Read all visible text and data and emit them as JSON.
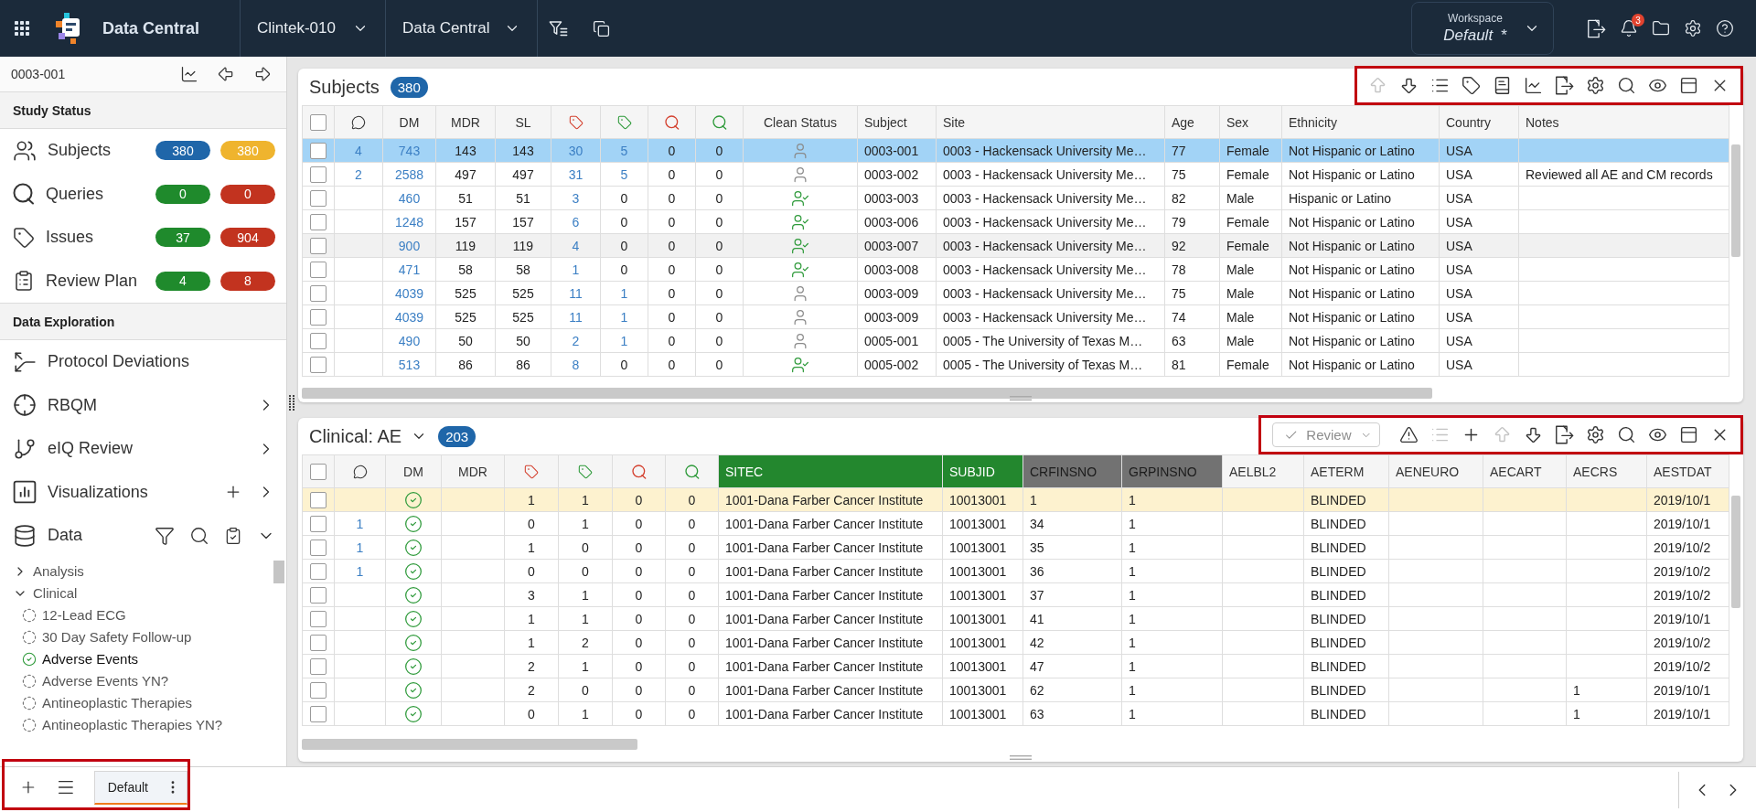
{
  "header": {
    "title": "Data Central",
    "study": "Clintek-010",
    "module": "Data Central",
    "workspace": {
      "label": "Workspace",
      "value": "Default",
      "suffix": "*"
    },
    "notifications": "3"
  },
  "sidebar": {
    "subject": "0003-001",
    "study_status": {
      "title": "Study Status",
      "items": [
        {
          "kind": "subjects",
          "label": "Subjects",
          "badges": [
            {
              "text": "380",
              "color": "#1f66a9"
            },
            {
              "text": "380",
              "color": "#efb42e"
            }
          ]
        },
        {
          "kind": "queries",
          "label": "Queries",
          "badges": [
            {
              "text": "0",
              "color": "#1f8a2c"
            },
            {
              "text": "0",
              "color": "#c2331f"
            }
          ]
        },
        {
          "kind": "issues",
          "label": "Issues",
          "badges": [
            {
              "text": "37",
              "color": "#1f8a2c"
            },
            {
              "text": "904",
              "color": "#c2331f"
            }
          ]
        },
        {
          "kind": "review_plan",
          "label": "Review Plan",
          "badges": [
            {
              "text": "4",
              "color": "#1f8a2c"
            },
            {
              "text": "8",
              "color": "#c2331f"
            }
          ]
        }
      ]
    },
    "data_exploration": {
      "title": "Data Exploration",
      "items": [
        {
          "kind": "protocol_deviations",
          "label": "Protocol Deviations"
        },
        {
          "kind": "rbqm",
          "label": "RBQM",
          "expanded": false
        },
        {
          "kind": "review",
          "label": "eIQ Review",
          "expanded": false
        },
        {
          "kind": "visualizations",
          "label": "Visualizations",
          "expanded": false
        },
        {
          "kind": "data",
          "label": "Data",
          "expanded": true
        }
      ]
    },
    "tree": [
      {
        "label": "Analysis",
        "expanded": false
      },
      {
        "label": "Clinical",
        "expanded": true,
        "children": [
          {
            "label": "12-Lead ECG",
            "complete": false
          },
          {
            "label": "30 Day Safety Follow-up",
            "complete": false
          },
          {
            "label": "Adverse Events",
            "complete": true
          },
          {
            "label": "Adverse Events YN?",
            "complete": false
          },
          {
            "label": "Antineoplastic Therapies",
            "complete": false
          },
          {
            "label": "Antineoplastic Therapies YN?",
            "complete": false
          }
        ]
      }
    ]
  },
  "subjects_panel": {
    "title": "Subjects",
    "count": "380",
    "toolbar": {
      "highlighted": true,
      "tools": [
        {
          "kind": "move_up",
          "disabled": true
        },
        {
          "kind": "move_down",
          "disabled": false
        },
        {
          "kind": "list",
          "disabled": false
        },
        {
          "kind": "tag",
          "disabled": false
        },
        {
          "kind": "book",
          "disabled": false
        },
        {
          "kind": "chart",
          "disabled": false
        },
        {
          "kind": "export",
          "disabled": false
        },
        {
          "kind": "settings",
          "disabled": false
        },
        {
          "kind": "search",
          "disabled": false
        },
        {
          "kind": "view",
          "disabled": false
        },
        {
          "kind": "layout",
          "disabled": false
        },
        {
          "kind": "close",
          "disabled": false
        }
      ]
    },
    "all_checked": false,
    "columns": [
      "DM",
      "MDR",
      "SL",
      "Clean Status",
      "Subject",
      "Site",
      "Age",
      "Sex",
      "Ethnicity",
      "Country",
      "Notes"
    ],
    "rows": [
      {
        "selected": true,
        "hovered": false,
        "checked": false,
        "comments": "4",
        "dm": "743",
        "mdr": "143",
        "sl": "143",
        "issues_open": "30",
        "issues_closed": "5",
        "queries_open": "0",
        "queries_closed": "0",
        "clean": false,
        "subject": "0003-001",
        "site": "0003 - Hackensack University Me…",
        "age": "77",
        "sex": "Female",
        "ethnicity": "Not Hispanic or Latino",
        "country": "USA"
      },
      {
        "selected": false,
        "hovered": false,
        "checked": false,
        "comments": "2",
        "dm": "2588",
        "mdr": "497",
        "sl": "497",
        "issues_open": "31",
        "issues_closed": "5",
        "queries_open": "0",
        "queries_closed": "0",
        "clean": false,
        "subject": "0003-002",
        "site": "0003 - Hackensack University Me…",
        "age": "75",
        "sex": "Female",
        "ethnicity": "Not Hispanic or Latino",
        "country": "USA",
        "notes": "Reviewed all AE and CM records"
      },
      {
        "selected": false,
        "hovered": false,
        "checked": false,
        "dm": "460",
        "mdr": "51",
        "sl": "51",
        "issues_open": "3",
        "issues_closed": "0",
        "queries_open": "0",
        "queries_closed": "0",
        "clean": true,
        "subject": "0003-003",
        "site": "0003 - Hackensack University Me…",
        "age": "82",
        "sex": "Male",
        "ethnicity": "Hispanic or Latino",
        "country": "USA"
      },
      {
        "selected": false,
        "hovered": false,
        "checked": false,
        "dm": "1248",
        "mdr": "157",
        "sl": "157",
        "issues_open": "6",
        "issues_closed": "0",
        "queries_open": "0",
        "queries_closed": "0",
        "clean": true,
        "subject": "0003-006",
        "site": "0003 - Hackensack University Me…",
        "age": "79",
        "sex": "Female",
        "ethnicity": "Not Hispanic or Latino",
        "country": "USA"
      },
      {
        "selected": false,
        "hovered": true,
        "checked": false,
        "dm": "900",
        "mdr": "119",
        "sl": "119",
        "issues_open": "4",
        "issues_closed": "0",
        "queries_open": "0",
        "queries_closed": "0",
        "clean": true,
        "subject": "0003-007",
        "site": "0003 - Hackensack University Me…",
        "age": "92",
        "sex": "Female",
        "ethnicity": "Not Hispanic or Latino",
        "country": "USA"
      },
      {
        "selected": false,
        "hovered": false,
        "checked": false,
        "dm": "471",
        "mdr": "58",
        "sl": "58",
        "issues_open": "1",
        "issues_closed": "0",
        "queries_open": "0",
        "queries_closed": "0",
        "clean": true,
        "subject": "0003-008",
        "site": "0003 - Hackensack University Me…",
        "age": "78",
        "sex": "Male",
        "ethnicity": "Not Hispanic or Latino",
        "country": "USA"
      },
      {
        "selected": false,
        "hovered": false,
        "checked": false,
        "dm": "4039",
        "mdr": "525",
        "sl": "525",
        "issues_open": "11",
        "issues_closed": "1",
        "queries_open": "0",
        "queries_closed": "0",
        "clean": false,
        "subject": "0003-009",
        "site": "0003 - Hackensack University Me…",
        "age": "75",
        "sex": "Male",
        "ethnicity": "Not Hispanic or Latino",
        "country": "USA"
      },
      {
        "selected": false,
        "hovered": false,
        "checked": false,
        "dm": "4039",
        "mdr": "525",
        "sl": "525",
        "issues_open": "11",
        "issues_closed": "1",
        "queries_open": "0",
        "queries_closed": "0",
        "clean": false,
        "subject": "0003-009",
        "site": "0003 - Hackensack University Me…",
        "age": "74",
        "sex": "Male",
        "ethnicity": "Not Hispanic or Latino",
        "country": "USA"
      },
      {
        "selected": false,
        "hovered": false,
        "checked": false,
        "dm": "490",
        "mdr": "50",
        "sl": "50",
        "issues_open": "2",
        "issues_closed": "1",
        "queries_open": "0",
        "queries_closed": "0",
        "clean": false,
        "subject": "0005-001",
        "site": "0005 - The University of Texas M…",
        "age": "63",
        "sex": "Male",
        "ethnicity": "Not Hispanic or Latino",
        "country": "USA"
      },
      {
        "selected": false,
        "hovered": false,
        "checked": false,
        "dm": "513",
        "mdr": "86",
        "sl": "86",
        "issues_open": "8",
        "issues_closed": "0",
        "queries_open": "0",
        "queries_closed": "0",
        "clean": true,
        "subject": "0005-002",
        "site": "0005 - The University of Texas M…",
        "age": "81",
        "sex": "Female",
        "ethnicity": "Not Hispanic or Latino",
        "country": "USA"
      }
    ]
  },
  "ae_panel": {
    "title": "Clinical: AE",
    "count": "203",
    "review": {
      "label": "Review",
      "disabled": true
    },
    "toolbar": {
      "highlighted": true,
      "tools": [
        {
          "kind": "flag_alert",
          "disabled": false
        },
        {
          "kind": "list",
          "disabled": true
        },
        {
          "kind": "add",
          "disabled": false
        },
        {
          "kind": "move_up",
          "disabled": true
        },
        {
          "kind": "move_down",
          "disabled": false
        },
        {
          "kind": "export",
          "disabled": false
        },
        {
          "kind": "settings",
          "disabled": false
        },
        {
          "kind": "search",
          "disabled": false
        },
        {
          "kind": "view",
          "disabled": false
        },
        {
          "kind": "layout",
          "disabled": false
        },
        {
          "kind": "close",
          "disabled": false
        }
      ]
    },
    "all_checked": false,
    "columns": [
      {
        "label": "DM"
      },
      {
        "label": "MDR"
      },
      {
        "label": "SITEC",
        "color": "#23872e"
      },
      {
        "label": "SUBJID",
        "color": "#23872e"
      },
      {
        "label": "CRFINSNO",
        "color": "#727272"
      },
      {
        "label": "GRPINSNO",
        "color": "#727272"
      },
      {
        "label": "AELBL2"
      },
      {
        "label": "AETERM"
      },
      {
        "label": "AENEURO"
      },
      {
        "label": "AECART"
      },
      {
        "label": "AECRS"
      },
      {
        "label": "AESTDAT"
      }
    ],
    "rows": [
      {
        "selected": true,
        "checked": false,
        "dm_verified": true,
        "issues_open": "1",
        "issues_closed": "1",
        "queries_open": "0",
        "queries_closed": "0",
        "sitec": "1001-Dana Farber Cancer Institute",
        "subjid": "10013001",
        "crfinsno": "1",
        "grpinsno": "1",
        "aeterm": "BLINDED",
        "aestdat": "2019/10/1"
      },
      {
        "selected": false,
        "checked": false,
        "comments": "1",
        "dm_verified": true,
        "issues_open": "0",
        "issues_closed": "1",
        "queries_open": "0",
        "queries_closed": "0",
        "sitec": "1001-Dana Farber Cancer Institute",
        "subjid": "10013001",
        "crfinsno": "34",
        "grpinsno": "1",
        "aeterm": "BLINDED",
        "aestdat": "2019/10/1"
      },
      {
        "selected": false,
        "checked": false,
        "comments": "1",
        "dm_verified": true,
        "issues_open": "1",
        "issues_closed": "0",
        "queries_open": "0",
        "queries_closed": "0",
        "sitec": "1001-Dana Farber Cancer Institute",
        "subjid": "10013001",
        "crfinsno": "35",
        "grpinsno": "1",
        "aeterm": "BLINDED",
        "aestdat": "2019/10/2"
      },
      {
        "selected": false,
        "checked": false,
        "comments": "1",
        "dm_verified": true,
        "issues_open": "0",
        "issues_closed": "0",
        "queries_open": "0",
        "queries_closed": "0",
        "sitec": "1001-Dana Farber Cancer Institute",
        "subjid": "10013001",
        "crfinsno": "36",
        "grpinsno": "1",
        "aeterm": "BLINDED",
        "aestdat": "2019/10/2"
      },
      {
        "selected": false,
        "checked": false,
        "dm_verified": true,
        "issues_open": "3",
        "issues_closed": "1",
        "queries_open": "0",
        "queries_closed": "0",
        "sitec": "1001-Dana Farber Cancer Institute",
        "subjid": "10013001",
        "crfinsno": "37",
        "grpinsno": "1",
        "aeterm": "BLINDED",
        "aestdat": "2019/10/2"
      },
      {
        "selected": false,
        "checked": false,
        "dm_verified": true,
        "issues_open": "1",
        "issues_closed": "1",
        "queries_open": "0",
        "queries_closed": "0",
        "sitec": "1001-Dana Farber Cancer Institute",
        "subjid": "10013001",
        "crfinsno": "41",
        "grpinsno": "1",
        "aeterm": "BLINDED",
        "aestdat": "2019/10/1"
      },
      {
        "selected": false,
        "checked": false,
        "dm_verified": true,
        "issues_open": "1",
        "issues_closed": "2",
        "queries_open": "0",
        "queries_closed": "0",
        "sitec": "1001-Dana Farber Cancer Institute",
        "subjid": "10013001",
        "crfinsno": "42",
        "grpinsno": "1",
        "aeterm": "BLINDED",
        "aestdat": "2019/10/2"
      },
      {
        "selected": false,
        "checked": false,
        "dm_verified": true,
        "issues_open": "2",
        "issues_closed": "1",
        "queries_open": "0",
        "queries_closed": "0",
        "sitec": "1001-Dana Farber Cancer Institute",
        "subjid": "10013001",
        "crfinsno": "47",
        "grpinsno": "1",
        "aeterm": "BLINDED",
        "aestdat": "2019/10/2"
      },
      {
        "selected": false,
        "checked": false,
        "dm_verified": true,
        "issues_open": "2",
        "issues_closed": "0",
        "queries_open": "0",
        "queries_closed": "0",
        "sitec": "1001-Dana Farber Cancer Institute",
        "subjid": "10013001",
        "crfinsno": "62",
        "grpinsno": "1",
        "aeterm": "BLINDED",
        "aecrs": "1",
        "aestdat": "2019/10/1"
      },
      {
        "selected": false,
        "checked": false,
        "dm_verified": true,
        "issues_open": "0",
        "issues_closed": "1",
        "queries_open": "0",
        "queries_closed": "0",
        "sitec": "1001-Dana Farber Cancer Institute",
        "subjid": "10013001",
        "crfinsno": "63",
        "grpinsno": "1",
        "aeterm": "BLINDED",
        "aecrs": "1",
        "aestdat": "2019/10/1"
      }
    ]
  },
  "bottom_bar": {
    "highlighted": true,
    "tabs": [
      {
        "label": "Default",
        "selected": true
      }
    ]
  }
}
